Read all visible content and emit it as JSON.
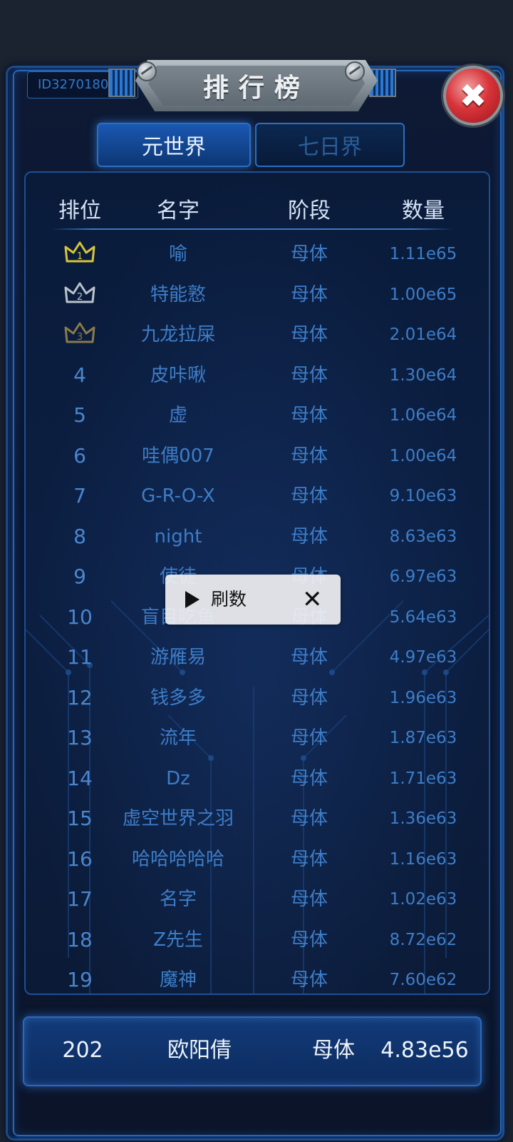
{
  "header": {
    "user_id": "ID3270180",
    "title": "排行榜",
    "close_icon": "close-icon"
  },
  "tabs": [
    {
      "label": "元世界",
      "active": true
    },
    {
      "label": "七日界",
      "active": false
    }
  ],
  "table": {
    "columns": [
      "排位",
      "名字",
      "阶段",
      "数量"
    ],
    "rows": [
      {
        "rank": "1",
        "name": "喻",
        "stage": "母体",
        "qty": "1.11e65",
        "badge": "gold-crown"
      },
      {
        "rank": "2",
        "name": "特能憝",
        "stage": "母体",
        "qty": "1.00e65",
        "badge": "silver-crown"
      },
      {
        "rank": "3",
        "name": "九龙拉屎",
        "stage": "母体",
        "qty": "2.01e64",
        "badge": "bronze-crown"
      },
      {
        "rank": "4",
        "name": "皮咔啾",
        "stage": "母体",
        "qty": "1.30e64"
      },
      {
        "rank": "5",
        "name": "虚",
        "stage": "母体",
        "qty": "1.06e64"
      },
      {
        "rank": "6",
        "name": "哇偶007",
        "stage": "母体",
        "qty": "1.00e64"
      },
      {
        "rank": "7",
        "name": "G-R-O-X",
        "stage": "母体",
        "qty": "9.10e63"
      },
      {
        "rank": "8",
        "name": "night",
        "stage": "母体",
        "qty": "8.63e63"
      },
      {
        "rank": "9",
        "name": "使徒",
        "stage": "母体",
        "qty": "6.97e63"
      },
      {
        "rank": "10",
        "name": "盲目吃鱼",
        "stage": "母体",
        "qty": "5.64e63"
      },
      {
        "rank": "11",
        "name": "游雁易",
        "stage": "母体",
        "qty": "4.97e63"
      },
      {
        "rank": "12",
        "name": "钱多多",
        "stage": "母体",
        "qty": "1.96e63"
      },
      {
        "rank": "13",
        "name": "流年",
        "stage": "母体",
        "qty": "1.87e63"
      },
      {
        "rank": "14",
        "name": "Dz",
        "stage": "母体",
        "qty": "1.71e63"
      },
      {
        "rank": "15",
        "name": "虚空世界之羽",
        "stage": "母体",
        "qty": "1.36e63"
      },
      {
        "rank": "16",
        "name": "哈哈哈哈哈",
        "stage": "母体",
        "qty": "1.16e63"
      },
      {
        "rank": "17",
        "name": "名字",
        "stage": "母体",
        "qty": "1.02e63"
      },
      {
        "rank": "18",
        "name": "Z先生",
        "stage": "母体",
        "qty": "8.72e62"
      },
      {
        "rank": "19",
        "name": "魔神",
        "stage": "母体",
        "qty": "7.60e62"
      }
    ]
  },
  "my_rank": {
    "rank": "202",
    "name": "欧阳倩",
    "stage": "母体",
    "qty": "4.83e56"
  },
  "overlay": {
    "play_icon": "play-icon",
    "label": "刷数",
    "close_icon": "close-icon"
  },
  "colors": {
    "accent": "#2a6fc4",
    "row_text": "#3d7dc8",
    "gold": "#d8c43a",
    "silver": "#b9c3cc",
    "bronze": "#8a7a4a",
    "close_red": "#d8343a"
  }
}
